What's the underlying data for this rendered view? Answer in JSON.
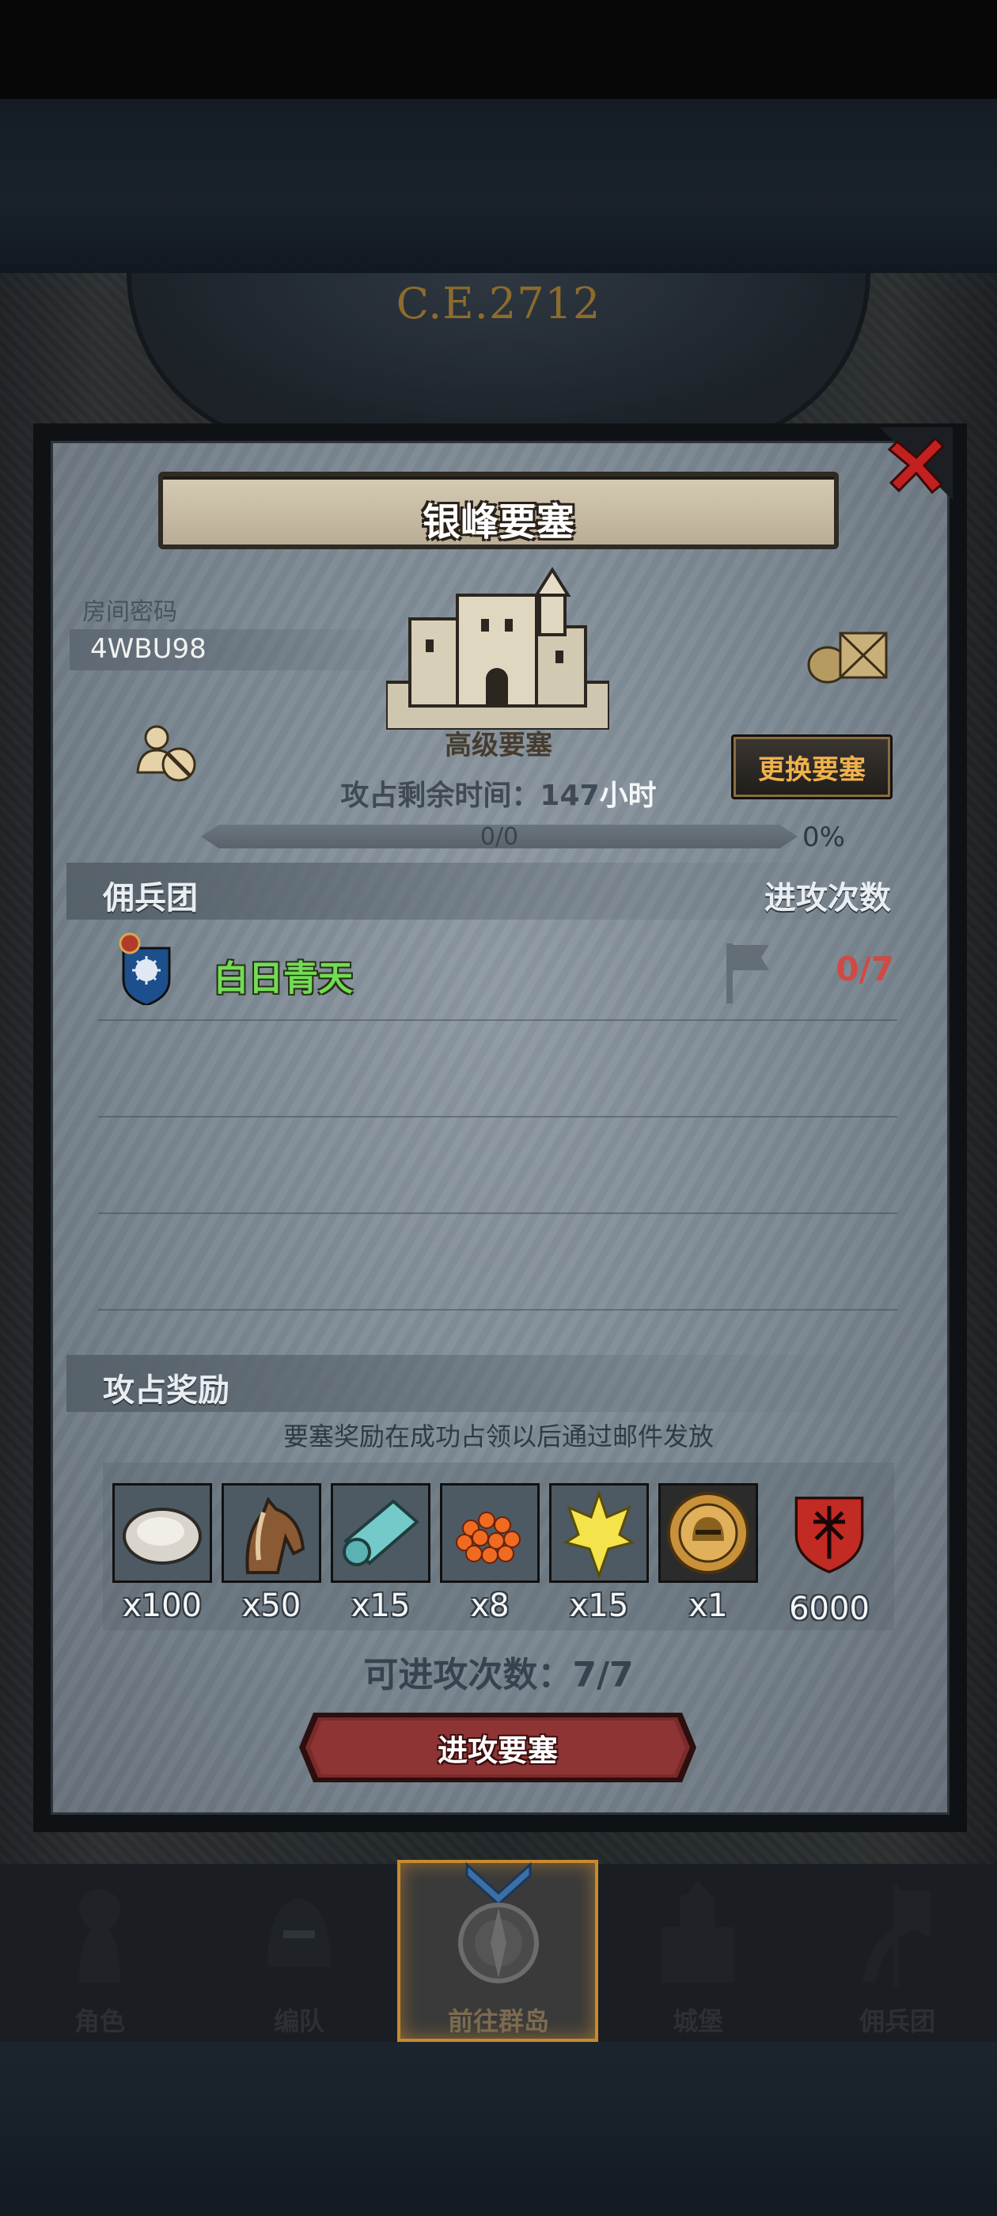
{
  "era": "C.E.2712",
  "dialog": {
    "title": "银峰要塞",
    "room_password_label": "房间密码",
    "room_password": "4WBU98",
    "fort_type": "高级要塞",
    "change_fort_label": "更换要塞",
    "time_left_label": "攻占剩余时间：",
    "time_left_value": "147",
    "time_left_unit": "小时",
    "progress": {
      "text": "0/0",
      "percent_text": "0%",
      "fill_fraction": 0
    },
    "guild_section": {
      "left_header": "佣兵团",
      "right_header": "进攻次数",
      "rows": [
        {
          "name": "白日青天",
          "count": "0/7"
        }
      ]
    },
    "rewards_section": {
      "header": "攻占奖励",
      "note": "要塞奖励在成功占领以后通过邮件发放",
      "items": [
        {
          "icon": "oyster-icon",
          "qty": "x100"
        },
        {
          "icon": "horse-icon",
          "qty": "x50"
        },
        {
          "icon": "cloth-icon",
          "qty": "x15"
        },
        {
          "icon": "roe-icon",
          "qty": "x8"
        },
        {
          "icon": "crown-crest-icon",
          "qty": "x15"
        },
        {
          "icon": "knight-medal-icon",
          "qty": "x1"
        },
        {
          "icon": "red-shield-icon",
          "qty": "6000"
        }
      ]
    },
    "attack_count_label": "可进攻次数：",
    "attack_count_value": "7/7",
    "attack_button": "进攻要塞"
  },
  "bottom_nav": [
    {
      "label": "角色",
      "icon": "knight-icon",
      "active": false
    },
    {
      "label": "编队",
      "icon": "helmet-icon",
      "active": false
    },
    {
      "label": "前往群岛",
      "icon": "compass-icon",
      "active": true
    },
    {
      "label": "城堡",
      "icon": "castle-icon",
      "active": false
    },
    {
      "label": "佣兵团",
      "icon": "banner-icon",
      "active": false
    }
  ],
  "colors": {
    "guild_name": "#72dc55",
    "attack_count_red": "#cf4a45",
    "change_button_text": "#f0b24c",
    "nav_active_border": "#c88a2f"
  }
}
